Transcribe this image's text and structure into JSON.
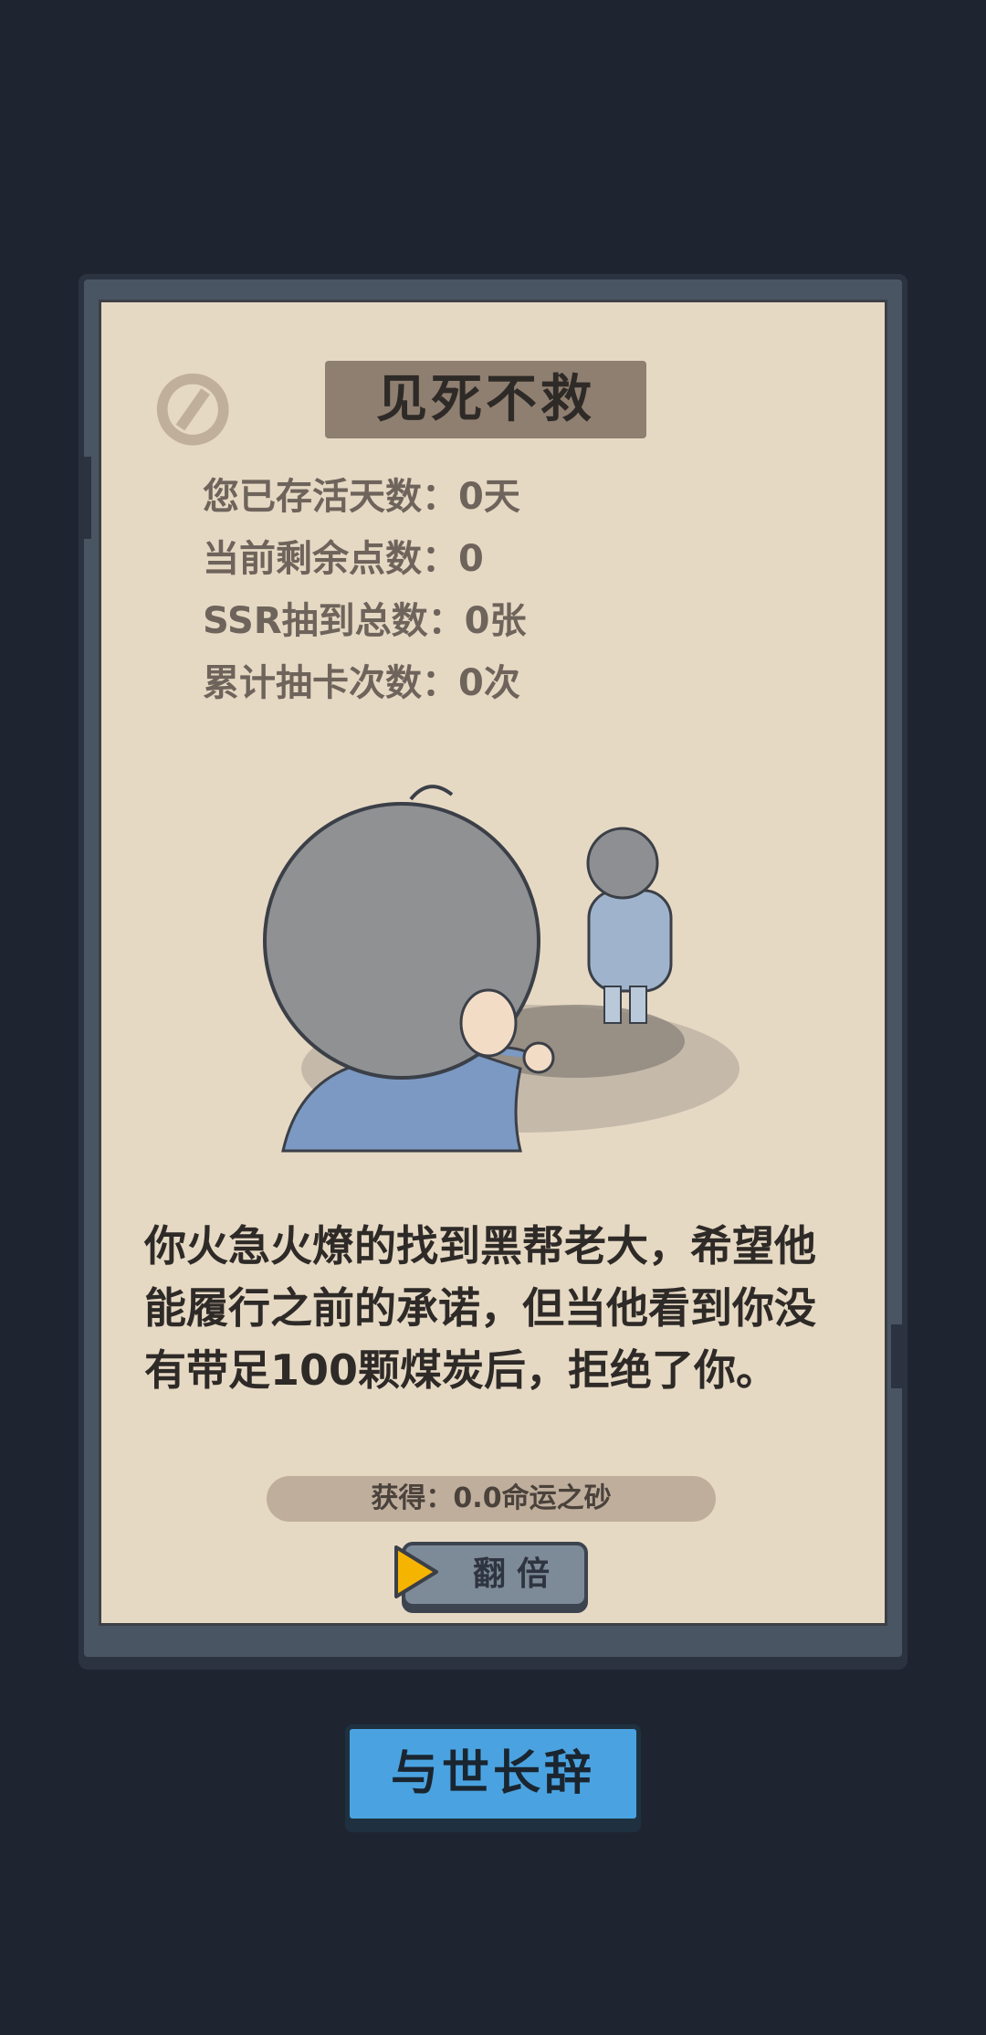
{
  "card": {
    "title": "见死不救",
    "stats": [
      "您已存活天数：0天",
      "当前剩余点数：0",
      "SSR抽到总数：0张",
      "累计抽卡次数：0次"
    ],
    "story": "你火急火燎的找到黑帮老大，希望他能履行之前的承诺，但当他看到你没有带足100颗煤炭后，拒绝了你。",
    "reward": "获得：0.0命运之砂",
    "double_label": "翻倍"
  },
  "action": {
    "main_label": "与世长辞"
  },
  "icons": {
    "play": "play-arrow-icon"
  },
  "colors": {
    "background": "#1e2530",
    "paper": "#e6d9c4",
    "main_button": "#4aa3e0",
    "play_icon": "#f5b400"
  }
}
